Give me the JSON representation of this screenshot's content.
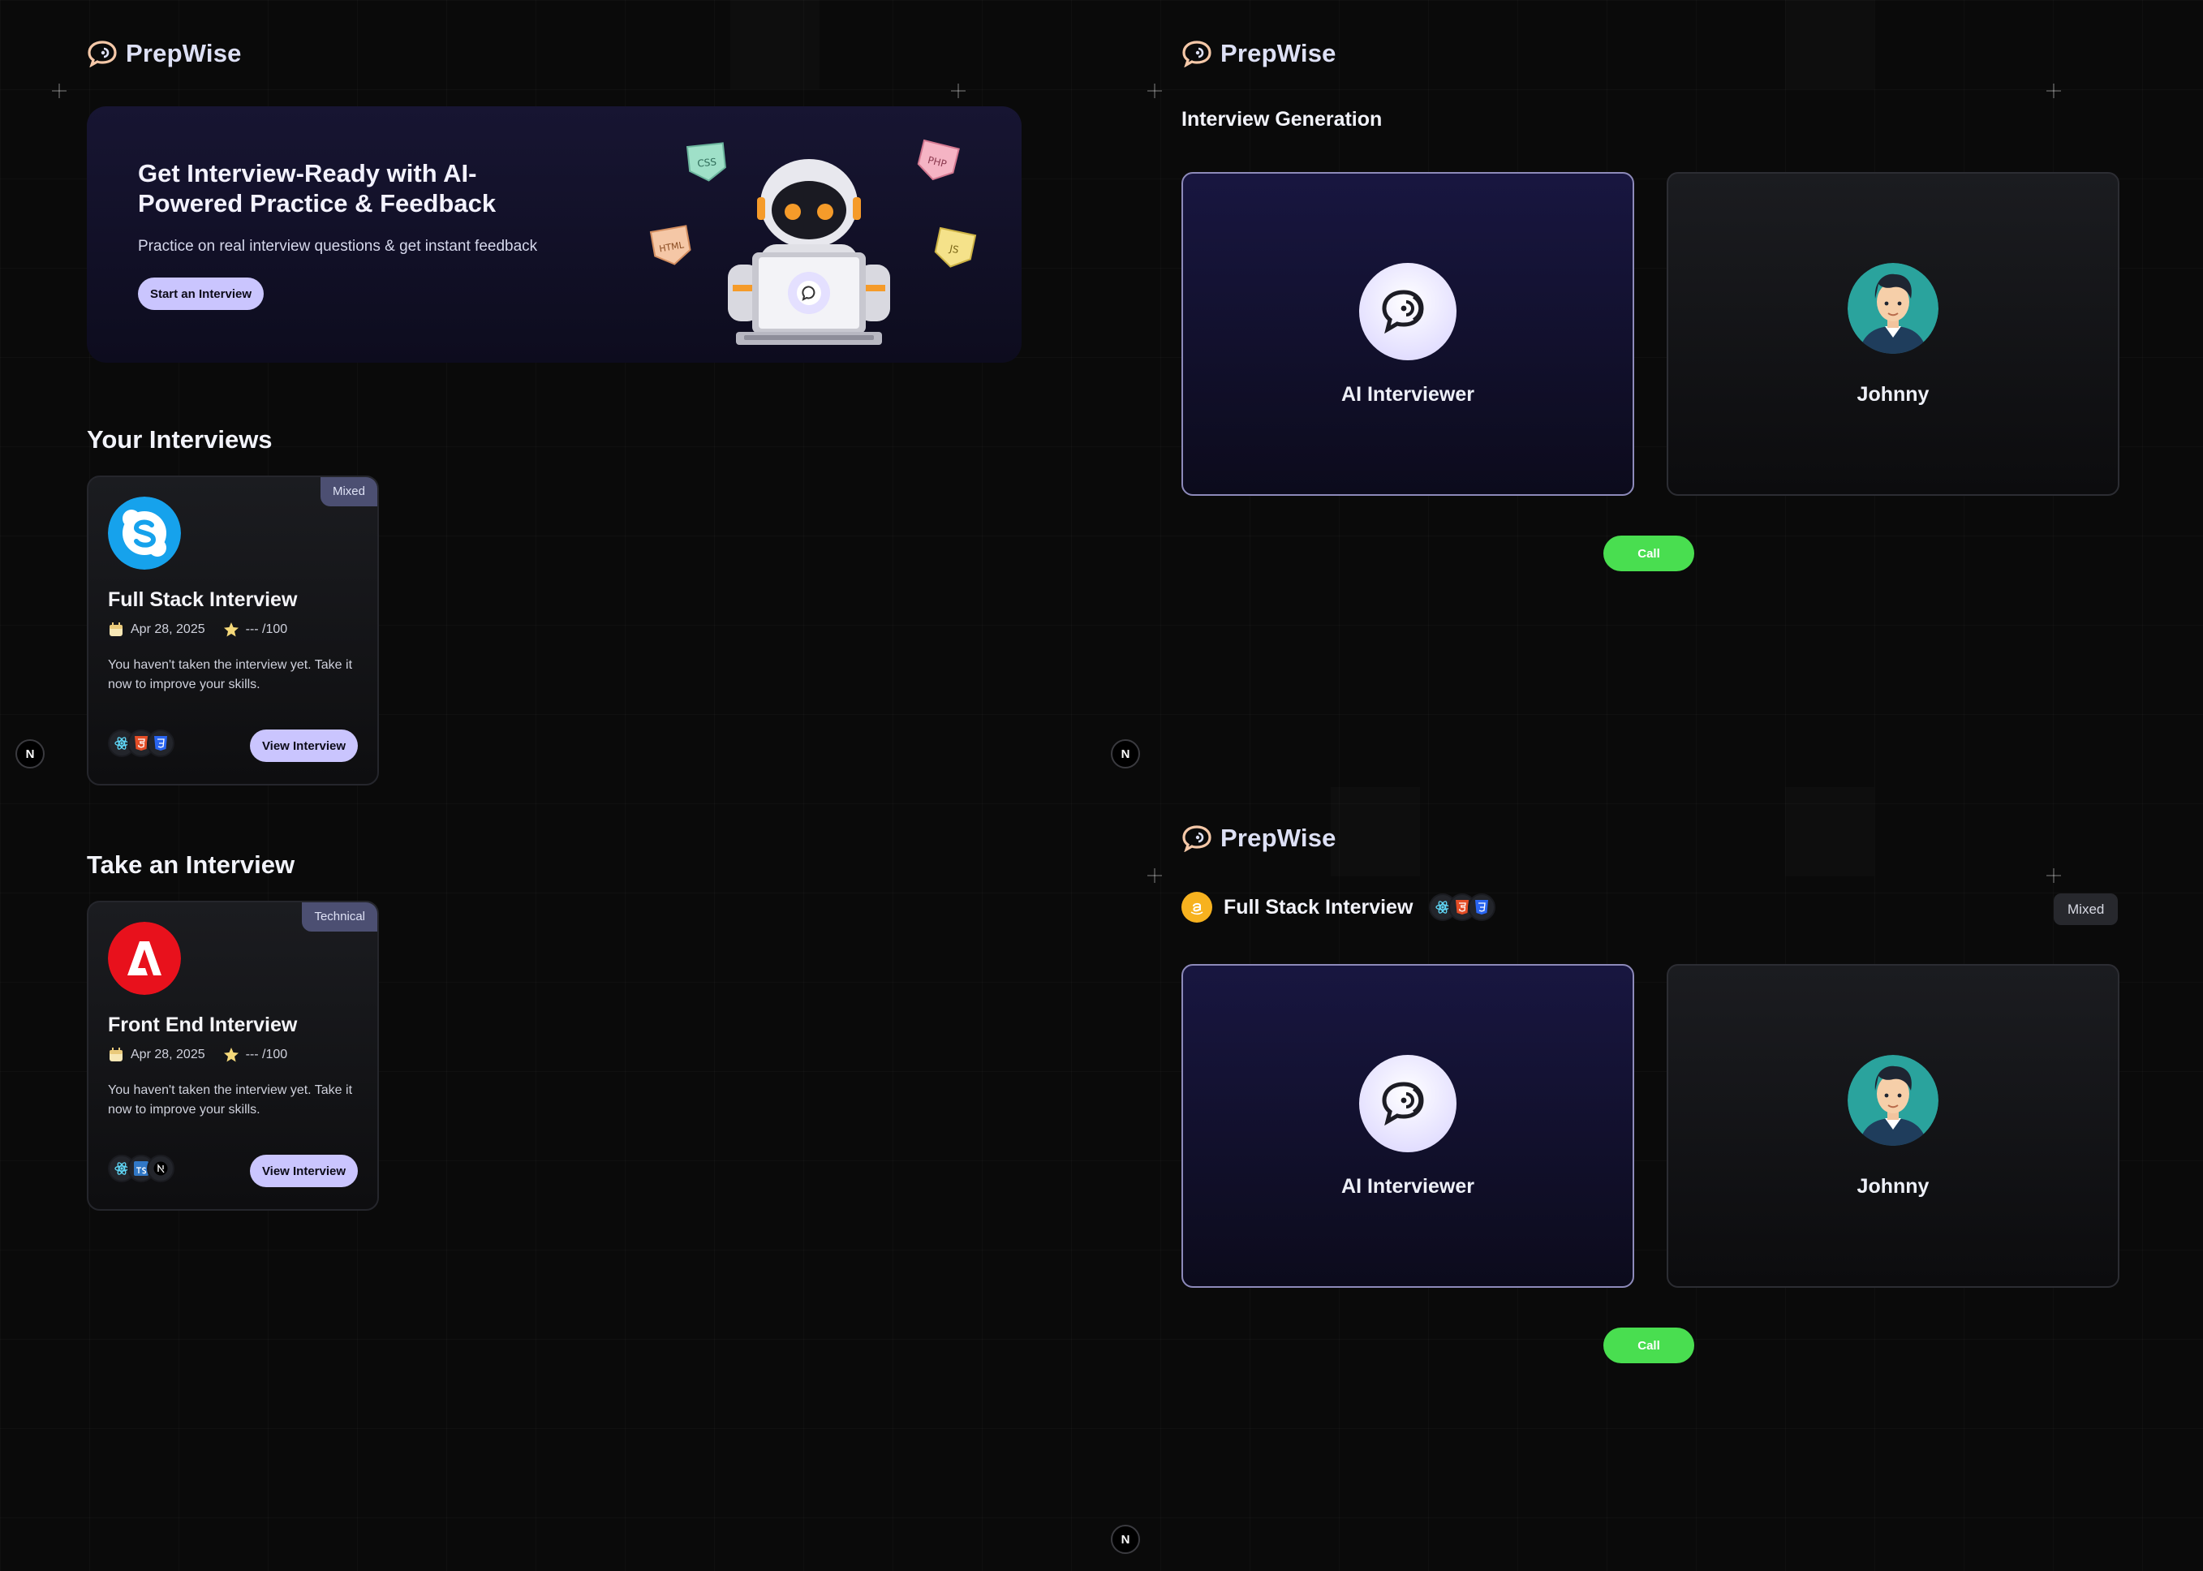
{
  "brand": {
    "name": "PrepWise"
  },
  "dashboard": {
    "hero": {
      "title": "Get Interview-Ready with AI-Powered Practice & Feedback",
      "subtitle": "Practice on real interview questions & get instant feedback",
      "cta": "Start an Interview",
      "stickers": [
        "CSS",
        "PHP",
        "HTML",
        "JS"
      ]
    },
    "your_interviews": {
      "title": "Your Interviews",
      "cards": [
        {
          "badge": "Mixed",
          "company_icon": "skype-logo",
          "title": "Full Stack Interview",
          "date": "Apr 28, 2025",
          "score": "--- /100",
          "description": "You haven't taken the interview yet. Take it now to improve your skills.",
          "techs": [
            "react-icon",
            "html5-icon",
            "css3-icon"
          ],
          "button": "View Interview"
        }
      ]
    },
    "take_interview": {
      "title": "Take an Interview",
      "cards": [
        {
          "badge": "Technical",
          "company_icon": "adobe-logo",
          "title": "Front End Interview",
          "date": "Apr 28, 2025",
          "score": "--- /100",
          "description": "You haven't taken the interview yet. Take it now to improve your skills.",
          "techs": [
            "react-icon",
            "typescript-icon",
            "nextjs-icon"
          ],
          "button": "View Interview"
        }
      ]
    }
  },
  "generation": {
    "title": "Interview Generation",
    "ai_name": "AI Interviewer",
    "user_name": "Johnny",
    "call": "Call"
  },
  "session": {
    "title": "Full Stack Interview",
    "badge": "Mixed",
    "techs": [
      "react-icon",
      "html5-icon",
      "css3-icon"
    ],
    "ai_name": "AI Interviewer",
    "user_name": "Johnny",
    "call": "Call"
  },
  "misc": {
    "next_badge": "N"
  },
  "colors": {
    "background": "#0a0a0a",
    "accent": "#cac5fe",
    "call_green": "#49de50",
    "badge": "#4c4f72"
  }
}
